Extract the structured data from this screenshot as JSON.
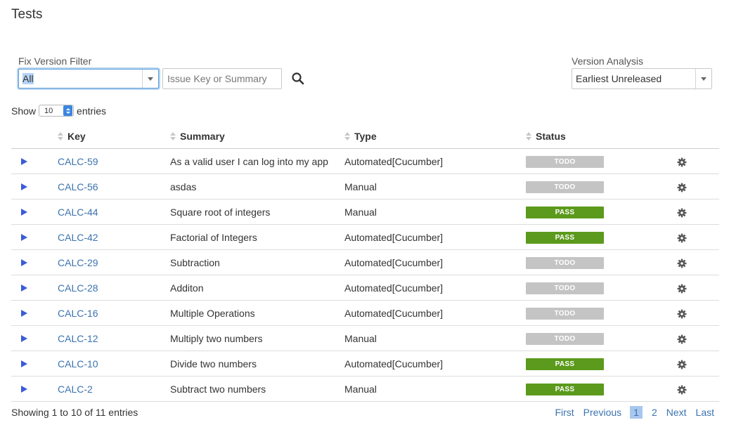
{
  "page": {
    "title": "Tests"
  },
  "filters": {
    "fix_version_label": "Fix Version Filter",
    "fix_version_value": "All",
    "search_placeholder": "Issue Key or Summary",
    "version_analysis_label": "Version Analysis",
    "version_analysis_value": "Earliest Unreleased"
  },
  "length_menu": {
    "show_label": "Show",
    "value": "10",
    "entries_label": "entries"
  },
  "table": {
    "columns": [
      "Key",
      "Summary",
      "Type",
      "Status"
    ],
    "rows": [
      {
        "key": "CALC-59",
        "summary": "As a valid user I can log into my app",
        "type": "Automated[Cucumber]",
        "status": "TODO"
      },
      {
        "key": "CALC-56",
        "summary": "asdas",
        "type": "Manual",
        "status": "TODO"
      },
      {
        "key": "CALC-44",
        "summary": "Square root of integers",
        "type": "Manual",
        "status": "PASS"
      },
      {
        "key": "CALC-42",
        "summary": "Factorial of Integers",
        "type": "Automated[Cucumber]",
        "status": "PASS"
      },
      {
        "key": "CALC-29",
        "summary": "Subtraction",
        "type": "Automated[Cucumber]",
        "status": "TODO"
      },
      {
        "key": "CALC-28",
        "summary": "Additon",
        "type": "Automated[Cucumber]",
        "status": "TODO"
      },
      {
        "key": "CALC-16",
        "summary": "Multiple Operations",
        "type": "Automated[Cucumber]",
        "status": "TODO"
      },
      {
        "key": "CALC-12",
        "summary": "Multiply two numbers",
        "type": "Manual",
        "status": "TODO"
      },
      {
        "key": "CALC-10",
        "summary": "Divide two numbers",
        "type": "Automated[Cucumber]",
        "status": "PASS"
      },
      {
        "key": "CALC-2",
        "summary": "Subtract two numbers",
        "type": "Manual",
        "status": "PASS"
      }
    ]
  },
  "status_colors": {
    "TODO": "#c4c4c4",
    "PASS": "#5b9a1c"
  },
  "icons": {
    "expand": "play-triangle-icon",
    "row_action": "gear-icon",
    "search": "magnifier-icon"
  },
  "footer": {
    "info": "Showing 1 to 10 of 11 entries"
  },
  "pagination": {
    "first": "First",
    "previous": "Previous",
    "pages": [
      "1",
      "2"
    ],
    "current": "1",
    "next": "Next",
    "last": "Last"
  }
}
